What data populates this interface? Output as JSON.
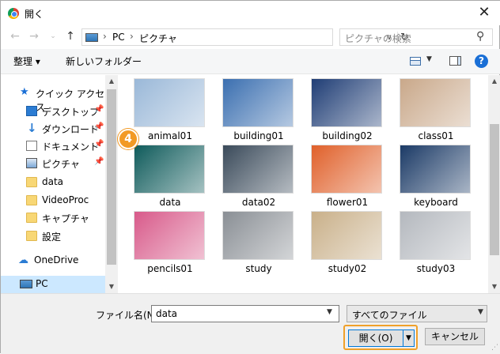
{
  "window": {
    "title": "開く",
    "close_glyph": "✕"
  },
  "nav": {
    "path": [
      "PC",
      "ピクチャ"
    ],
    "search_placeholder": "ピクチャの検索"
  },
  "toolbar": {
    "organize": "整理 ▾",
    "new_folder": "新しいフォルダー"
  },
  "sidebar": {
    "items": [
      {
        "label": "クイック アクセス",
        "icon": "star-icon"
      },
      {
        "label": "デスクトップ",
        "icon": "desktop-icon",
        "pinned": true
      },
      {
        "label": "ダウンロード",
        "icon": "download-icon",
        "pinned": true
      },
      {
        "label": "ドキュメント",
        "icon": "document-icon",
        "pinned": true
      },
      {
        "label": "ピクチャ",
        "icon": "pictures-icon",
        "pinned": true
      },
      {
        "label": "data",
        "icon": "folder-icon"
      },
      {
        "label": "VideoProc",
        "icon": "folder-icon"
      },
      {
        "label": "キャプチャ",
        "icon": "folder-icon"
      },
      {
        "label": "設定",
        "icon": "folder-icon"
      },
      {
        "label": "OneDrive",
        "icon": "cloud-icon"
      },
      {
        "label": "PC",
        "icon": "pc-icon",
        "selected": true
      }
    ]
  },
  "files": [
    {
      "name": "animal01",
      "color": "#9ab8d8"
    },
    {
      "name": "building01",
      "color": "#3b6fb0"
    },
    {
      "name": "building02",
      "color": "#1f3d75"
    },
    {
      "name": "class01",
      "color": "#c9a88a"
    },
    {
      "name": "data",
      "color": "#0f5b5b",
      "selected": true
    },
    {
      "name": "data02",
      "color": "#3a4a5a"
    },
    {
      "name": "flower01",
      "color": "#e0602a"
    },
    {
      "name": "keyboard",
      "color": "#1b3a66"
    },
    {
      "name": "pencils01",
      "color": "#d85a8a"
    },
    {
      "name": "study",
      "color": "#8a8f95"
    },
    {
      "name": "study02",
      "color": "#c9b089"
    },
    {
      "name": "study03",
      "color": "#b4b8be"
    }
  ],
  "badge": {
    "number": "4"
  },
  "footer": {
    "filename_label": "ファイル名(N):",
    "filename_value": "data",
    "filetype": "すべてのファイル",
    "open_label": "開く(O)",
    "cancel_label": "キャンセル"
  }
}
